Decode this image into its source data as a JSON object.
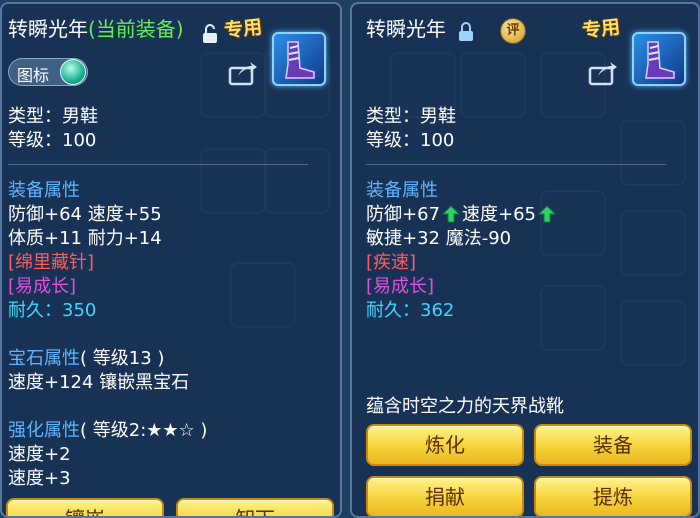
{
  "left": {
    "title": "转瞬光年",
    "equipped_tag": "(当前装备)",
    "exclusive": "专用",
    "toggle_label": "图标",
    "type": "类型：男鞋",
    "level": "等级：100",
    "attr_header": "装备属性",
    "attr_line1": "防御+64 速度+55",
    "attr_line2": "体质+11 耐力+14",
    "special1": "[绵里藏针]",
    "special2": "[易成长]",
    "durability_label": "耐久：",
    "durability_value": "350",
    "gem_header": "宝石属性",
    "gem_level": "( 等级13 )",
    "gem_line": "速度+124 镶嵌黑宝石",
    "enhance_header": "强化属性",
    "enhance_level": "( 等级2:★★☆ )",
    "enhance_line1": "速度+2",
    "enhance_line2": "速度+3",
    "btn1": "镶嵌",
    "btn2": "卸下"
  },
  "right": {
    "title": "转瞬光年",
    "eval": "评",
    "exclusive": "专用",
    "type": "类型：男鞋",
    "level": "等级：100",
    "attr_header": "装备属性",
    "attr_def": "防御+67",
    "attr_spd": "速度+65",
    "attr_line2": "敏捷+32 魔法-90",
    "special1": "[疾速]",
    "special2": "[易成长]",
    "durability_label": "耐久：",
    "durability_value": "362",
    "desc": "蕴含时空之力的天界战靴",
    "buttons": [
      "炼化",
      "装备",
      "捐献",
      "提炼"
    ]
  },
  "colors": {
    "header_blue": "#5fb5ff",
    "durability_cyan": "#3fd6ff",
    "special_red": "#ff5c5c",
    "special_magenta": "#e04fe0",
    "equipped_green": "#63f04d",
    "button_gold": "#f5d238"
  },
  "icons": [
    "boots-item-icon",
    "share-icon",
    "lock-icon",
    "evaluate-icon",
    "up-arrow-icon",
    "toggle-switch"
  ]
}
